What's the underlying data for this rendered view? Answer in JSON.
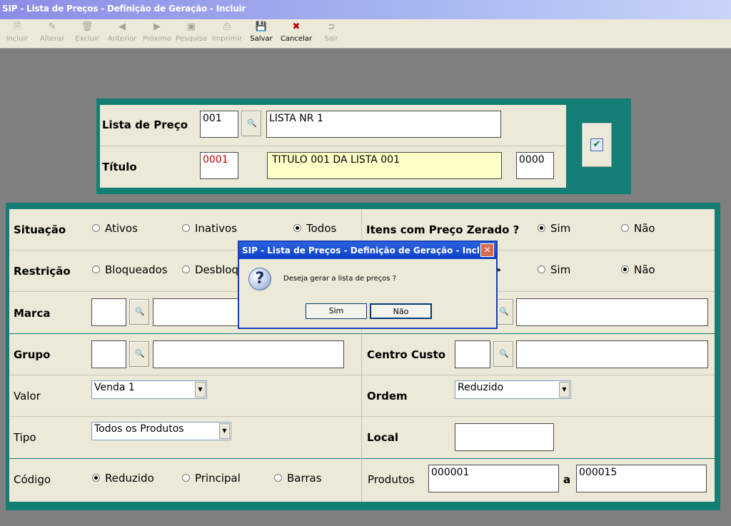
{
  "window": {
    "title": "SIP - Lista de Preços - Definição de Geração - Incluir"
  },
  "toolbar": {
    "items": [
      {
        "label": "Incluir",
        "icon": "new-document-icon",
        "enabled": false
      },
      {
        "label": "Alterar",
        "icon": "edit-icon",
        "enabled": false
      },
      {
        "label": "Excluir",
        "icon": "trash-icon",
        "enabled": false
      },
      {
        "label": "Anterior",
        "icon": "arrow-left-icon",
        "enabled": false
      },
      {
        "label": "Próximo",
        "icon": "arrow-right-icon",
        "enabled": false
      },
      {
        "label": "Pesquisa",
        "icon": "search-icon",
        "enabled": false
      },
      {
        "label": "Imprimir",
        "icon": "printer-icon",
        "enabled": false
      },
      {
        "label": "Salvar",
        "icon": "floppy-disk-icon",
        "enabled": true
      },
      {
        "label": "Cancelar",
        "icon": "cancel-icon",
        "enabled": true
      },
      {
        "label": "Sair",
        "icon": "exit-icon",
        "enabled": false
      }
    ]
  },
  "header": {
    "lista_label": "Lista de Preço",
    "lista_code": "001",
    "lista_name": "LISTA NR 1",
    "titulo_label": "Título",
    "titulo_code": "0001",
    "titulo_desc": "TITULO 001 DA LISTA 001",
    "titulo_extra": "0000",
    "confirm_icon": "checkmark-icon"
  },
  "form": {
    "situacao": {
      "label": "Situação",
      "options": [
        "Ativos",
        "Inativos",
        "Todos"
      ],
      "selected": "Todos"
    },
    "itens_zerado": {
      "label": "Itens com Preço Zerado ?",
      "options": [
        "Sim",
        "Não"
      ],
      "selected": "Sim"
    },
    "restricao": {
      "label": "Restrição",
      "options": [
        "Bloqueados",
        "Desbloq"
      ],
      "selected": ""
    },
    "restricao_right": {
      "partial_label": ">",
      "options": [
        "Sim",
        "Não"
      ],
      "selected": "Não"
    },
    "marca": {
      "label": "Marca",
      "code": "",
      "desc": "",
      "right_desc": ""
    },
    "grupo": {
      "label": "Grupo",
      "code": "",
      "desc": ""
    },
    "centro_custo": {
      "label": "Centro Custo",
      "code": "",
      "desc": ""
    },
    "valor": {
      "label": "Valor",
      "value": "Venda 1"
    },
    "ordem": {
      "label": "Ordem",
      "value": "Reduzido"
    },
    "tipo": {
      "label": "Tipo",
      "value": "Todos os Produtos"
    },
    "local": {
      "label": "Local",
      "value": ""
    },
    "codigo": {
      "label": "Código",
      "options": [
        "Reduzido",
        "Principal",
        "Barras"
      ],
      "selected": "Reduzido"
    },
    "produtos": {
      "label": "Produtos",
      "from": "000001",
      "sep": "a",
      "to": "000015"
    }
  },
  "dialog": {
    "title": "SIP - Lista de Preços - Definição de Geração - Incluir",
    "icon": "question-icon",
    "message": "Deseja gerar a lista de preços ?",
    "yes_label": "Sim",
    "no_label": "Não",
    "close_icon": "close-icon"
  }
}
